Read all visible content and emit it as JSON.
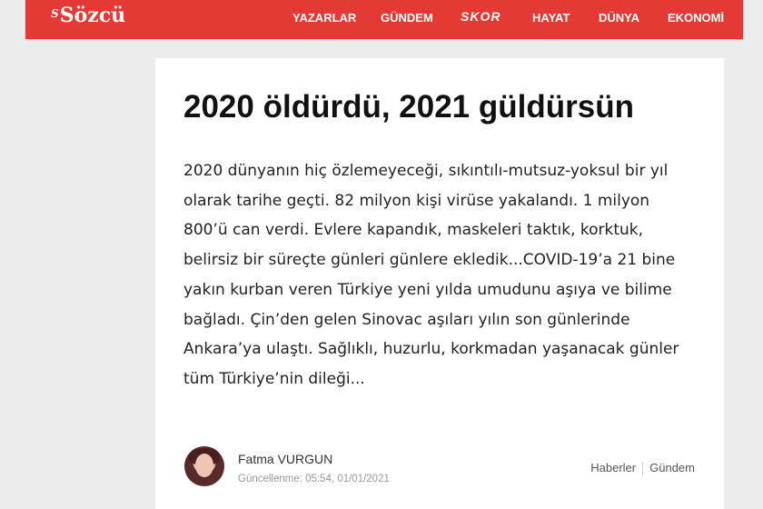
{
  "header": {
    "logo": "Sözcü",
    "logo_mark": "S",
    "nav": [
      {
        "label": "YAZARLAR"
      },
      {
        "label": "GÜNDEM"
      },
      {
        "label": "SKOR"
      },
      {
        "label": "HAYAT"
      },
      {
        "label": "DÜNYA"
      },
      {
        "label": "EKONOMİ"
      }
    ]
  },
  "article": {
    "title": "2020 öldürdü, 2021 güldürsün",
    "summary": "2020 dünyanın hiç özlemeyeceği, sıkıntılı-mutsuz-yoksul bir yıl olarak tarihe geçti. 82 milyon kişi virüse yakalandı. 1 milyon 800’ü can verdi. Evlere kapandık, maskeleri taktık, korktuk, belirsiz bir süreçte günleri günlere ekledik...COVID-19’a 21 bine yakın kurban veren Türkiye yeni yılda umudunu aşıya ve bilime bağladı. Çin’den gelen Sinovac aşıları yılın son günlerinde Ankara’ya ulaştı. Sağlıklı, huzurlu, korkmadan yaşanacak günler tüm Türkiye’nin dileği...",
    "author": "Fatma VURGUN",
    "updated": "Güncellenme: 05:54, 01/01/2021",
    "breadcrumbs": [
      {
        "label": "Haberler"
      },
      {
        "label": "Gündem"
      }
    ]
  },
  "colors": {
    "brand": "#e53935",
    "page_background": "#ececec"
  }
}
